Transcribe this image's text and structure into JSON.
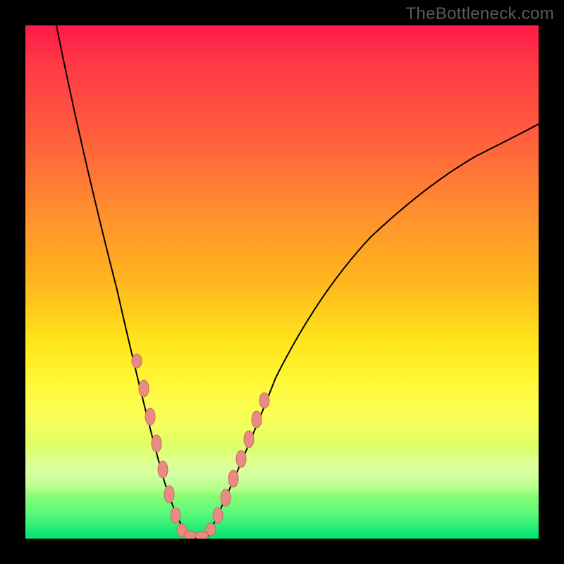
{
  "watermark": "TheBottleneck.com",
  "colors": {
    "frame_bg": "#000000",
    "gradient_top": "#ff1a49",
    "gradient_mid": "#ffe61a",
    "gradient_bottom": "#00e472",
    "curve_stroke": "#000000",
    "bead_fill": "#e98b82",
    "bead_stroke": "#c56a61"
  },
  "chart_data": {
    "type": "line",
    "title": "",
    "xlabel": "",
    "ylabel": "",
    "xlim": [
      0,
      100
    ],
    "ylim": [
      0,
      100
    ],
    "grid": false,
    "legend": false,
    "series": [
      {
        "name": "bottleneck-curve",
        "x": [
          6,
          10,
          15,
          20,
          22,
          25,
          27,
          28,
          30,
          32,
          34,
          36,
          40,
          45,
          50,
          55,
          60,
          65,
          70,
          75,
          80,
          85,
          90,
          95,
          100
        ],
        "y": [
          100,
          86,
          69,
          51,
          43,
          30,
          20,
          14,
          6,
          0,
          0,
          4,
          15,
          27,
          38,
          47,
          54,
          60,
          65,
          69,
          73,
          76,
          78,
          80,
          81
        ]
      }
    ],
    "markers": [
      {
        "name": "beads-left",
        "x": [
          21.5,
          23,
          24.5,
          26,
          27.5,
          29,
          30.5,
          32
        ],
        "y": [
          45,
          38,
          31,
          24,
          17,
          10,
          4,
          0
        ]
      },
      {
        "name": "beads-bottom",
        "x": [
          32,
          33.5,
          35
        ],
        "y": [
          0,
          0,
          0
        ]
      },
      {
        "name": "beads-right",
        "x": [
          35.5,
          37,
          38.5,
          40,
          41.5,
          43,
          44.5,
          46
        ],
        "y": [
          3,
          7.5,
          12,
          16,
          20,
          24,
          27.5,
          30
        ]
      }
    ],
    "annotations": []
  }
}
